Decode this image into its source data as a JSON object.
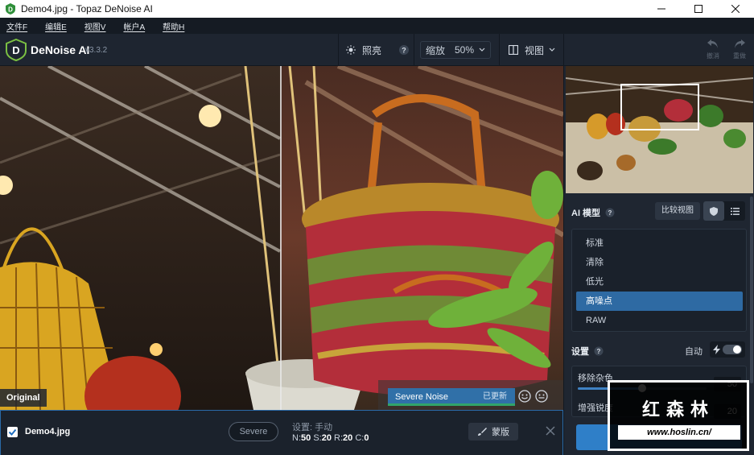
{
  "window": {
    "title": "Demo4.jpg - Topaz DeNoise AI",
    "controls": {
      "minimize": "—",
      "maximize": "☐",
      "close": "✕"
    }
  },
  "menu": [
    {
      "label": "文件F"
    },
    {
      "label": "编辑E"
    },
    {
      "label": "视图V"
    },
    {
      "label": "帐户A"
    },
    {
      "label": "帮助H"
    }
  ],
  "toolbar": {
    "brand": "DeNoise AI",
    "version": "v3.3.2",
    "light_label": "照亮",
    "zoom_label": "缩放",
    "zoom_value": "50%",
    "view_label": "视图",
    "undo_label": "撤消",
    "redo_label": "重做"
  },
  "viewer": {
    "original_label": "Original",
    "model_label": "Severe Noise",
    "updated_label": "已更新"
  },
  "filestrip": {
    "filename": "Demo4.jpg",
    "checked": true,
    "preset_pill": "Severe",
    "settings_text": "设置: 手动",
    "n_label": "N:",
    "n_value": "50",
    "s_label": "S:",
    "s_value": "20",
    "r_label": "R:",
    "r_value": "20",
    "c_label": "C:",
    "c_value": "0",
    "mask_label": "蒙版"
  },
  "panel": {
    "ai_model_label": "AI 模型",
    "compare_label": "比较视图",
    "models": [
      {
        "label": "标准",
        "selected": false
      },
      {
        "label": "清除",
        "selected": false
      },
      {
        "label": "低光",
        "selected": false
      },
      {
        "label": "高噪点",
        "selected": true
      },
      {
        "label": "RAW",
        "selected": false
      }
    ],
    "settings_label": "设置",
    "auto_label": "自动",
    "sliders": [
      {
        "label": "移除杂色",
        "value": "50",
        "fraction": 0.5
      },
      {
        "label": "增强锐度",
        "value": "20",
        "fraction": 0.2
      }
    ]
  },
  "watermark": {
    "text": "红森林",
    "url": "www.hoslin.cn/"
  },
  "colors": {
    "accent": "#2f7fc8",
    "selected_model": "#2e6aa3",
    "panel_bg": "#1f2631",
    "updated_bar": "#31a46a"
  }
}
